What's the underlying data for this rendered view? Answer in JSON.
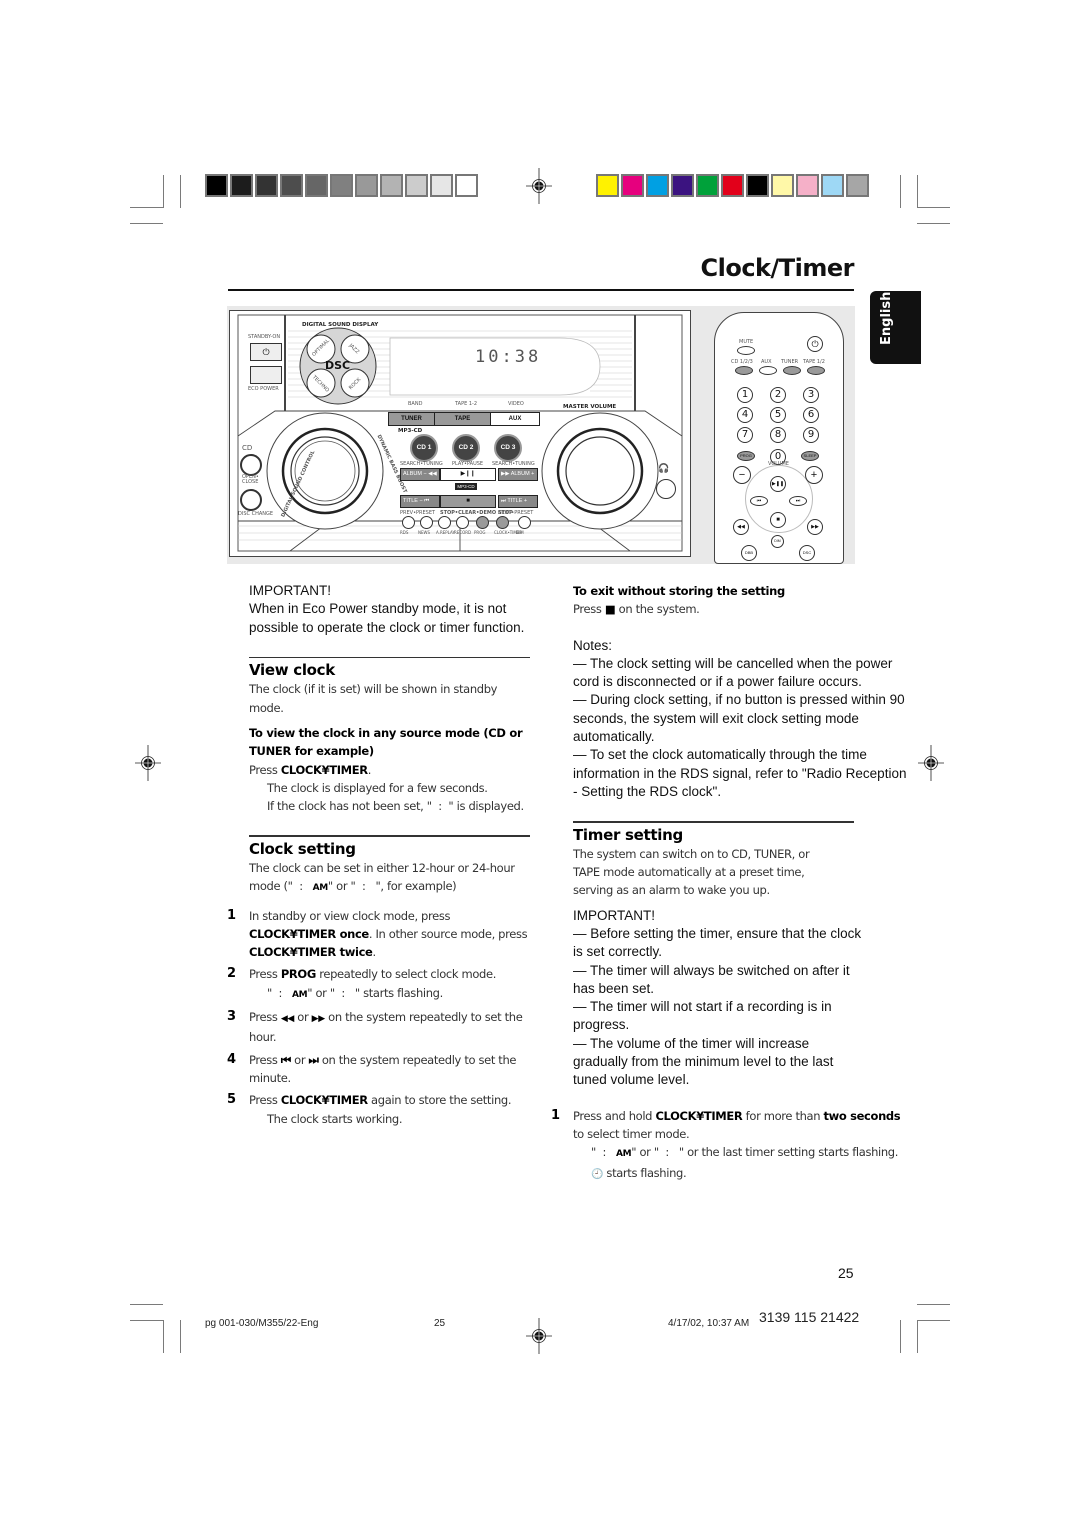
{
  "print_marks": {
    "grayscale_swatches": [
      "#000000",
      "#1c1c1c",
      "#333333",
      "#4d4d4d",
      "#666666",
      "#808080",
      "#999999",
      "#b3b3b3",
      "#cccccc",
      "#e6e6e6",
      "#ffffff"
    ],
    "color_swatches": [
      "#fff200",
      "#e6007e",
      "#00a0e3",
      "#3b1380",
      "#00a13a",
      "#e2001a",
      "#000000",
      "#fff8a8",
      "#f5b0c8",
      "#9ed8f5",
      "#a6a6a6"
    ]
  },
  "header": {
    "title": "Clock/Timer",
    "language_tab": "English"
  },
  "illustration": {
    "unit": {
      "display_label": "DIGITAL SOUND DISPLAY",
      "standby_label": "STANDBY-ON",
      "eco_power_label": "ECO POWER",
      "dsc_label": "DSC",
      "dsc_modes": [
        "OPTIMAL",
        "JAZZ",
        "TECHNO",
        "ROCK"
      ],
      "display_time": "10:38",
      "source_labels": [
        "BAND",
        "TAPE 1-2",
        "VIDEO"
      ],
      "source_buttons": [
        "TUNER",
        "TAPE",
        "AUX"
      ],
      "master_volume_label": "MASTER VOLUME",
      "mp3_cd_label": "MP3-CD",
      "cd_buttons": [
        "CD 1",
        "CD 2",
        "CD 3"
      ],
      "cd_label": "CD",
      "open_close_label": "OPEN• CLOSE",
      "disc_change_label": "DISC CHANGE",
      "left_knob_label": "DIGITAL SOUND CONTROL",
      "right_arc_label": "DYNAMIC BASS BOOST",
      "transport_top_labels": [
        "SEARCH•TUNING",
        "PLAY•PAUSE",
        "SEARCH•TUNING"
      ],
      "album_minus": "ALBUM −",
      "album_plus": "ALBUM +",
      "play_pause_symbol": "▶❙❙",
      "rewind_symbol": "◀◀",
      "forward_symbol": "▶▶",
      "title_minus": "TITLE −",
      "title_plus": "TITLE +",
      "prev_symbol": "⏮",
      "next_symbol": "⏭",
      "stop_symbol": "■",
      "transport_bottom_labels": [
        "PREV•PRESET",
        "STOP•CLEAR•DEMO STOP",
        "NEXT•PRESET"
      ],
      "small_buttons": [
        "RDS",
        "NEWS",
        "A.REPLAY",
        "RECORD",
        "PROG",
        "CLOCK•TIMER",
        "DIM"
      ]
    },
    "remote": {
      "mute_label": "MUTE",
      "source_labels": [
        "CD 1/2/3",
        "AUX",
        "TUNER",
        "TAPE 1/2"
      ],
      "digits": [
        "1",
        "2",
        "3",
        "4",
        "5",
        "6",
        "7",
        "8",
        "9",
        "0"
      ],
      "prog_label": "PROG",
      "sleep_label": "SLEEP",
      "volume_label": "VOLUME",
      "minus": "−",
      "plus": "+",
      "dim_label": "DIM",
      "dbb_label": "DBB",
      "dsc_label": "DSC"
    }
  },
  "left_column": {
    "important_heading": "IMPORTANT!",
    "important_text": "When in Eco Power standby mode, it is not possible to operate the clock or timer function.",
    "view_clock": {
      "heading": "View clock",
      "intro": "The clock (if it is set) will be shown in standby mode.",
      "subheading": "To view the clock in any source mode (CD or TUNER for example)",
      "press_prefix": "Press ",
      "press_button": "CLOCK¥TIMER",
      "press_suffix": ".",
      "result_1": "The clock is displayed for a few seconds.",
      "result_2": "If the clock has not been set, \"  :  \" is displayed."
    },
    "clock_setting": {
      "heading": "Clock setting",
      "intro_a": "The clock can be set in either 12-hour or 24-hour mode (\"  :   ",
      "intro_am": "AM",
      "intro_b": "\" or \"  :   \", for example)",
      "steps": [
        {
          "num": "1",
          "a": "In standby or view clock mode, press ",
          "b": "CLOCK¥TIMER once",
          "c": ".  In other source mode, press ",
          "d": "CLOCK¥TIMER twice",
          "e": "."
        },
        {
          "num": "2",
          "a": "Press ",
          "b": "PROG",
          "c": " repeatedly to select clock mode.",
          "sub_a": "\"  :   ",
          "sub_am": "AM",
          "sub_b": "\" or \"  :   \" starts flashing."
        },
        {
          "num": "3",
          "a": "Press ",
          "b": "◀◀",
          "c": " or ",
          "d": "▶▶",
          "e": " on the system repeatedly to set the hour."
        },
        {
          "num": "4",
          "a": "Press ",
          "b": "⏮",
          "c": " or ",
          "d": "⏭",
          "e": " on the system repeatedly to set the minute."
        },
        {
          "num": "5",
          "a": "Press ",
          "b": "CLOCK¥TIMER",
          "c": " again to store the setting.",
          "sub": "The clock starts working."
        }
      ]
    }
  },
  "right_column": {
    "exit_heading": "To exit without storing the setting",
    "exit_prefix": "Press ",
    "exit_symbol": "■",
    "exit_suffix": " on the system.",
    "notes_heading": "Notes:",
    "notes": [
      "—  The clock setting will be cancelled when the power cord is disconnected or if a power failure occurs.",
      "—  During clock setting, if no button is pressed within 90 seconds, the system will exit clock setting mode automatically.",
      "—  To set the clock automatically through the time information in the RDS signal, refer to \"Radio Reception - Setting the RDS clock\"."
    ],
    "timer_setting": {
      "heading": "Timer setting",
      "intro": "The system can switch on to CD, TUNER, or TAPE mode automatically at a preset time, serving as an alarm to wake you up.",
      "important_heading": "IMPORTANT!",
      "important_items": [
        "—  Before setting the timer, ensure that the clock is set correctly.",
        "—  The timer will always be switched on after it has been set.",
        "—  The timer will not start if a recording is in progress.",
        "—  The volume of the timer will increase gradually from the minimum level to the last tuned volume level."
      ],
      "step1": {
        "num": "1",
        "a": "Press and hold ",
        "b": "CLOCK¥TIMER",
        "c": " for more than ",
        "d": "two seconds",
        "e": " to select timer mode.",
        "sub_a": "\"  :   ",
        "sub_am": "AM",
        "sub_b": "\" or \"  :   \" or the last timer setting starts flashing.",
        "sub2": "starts flashing."
      }
    }
  },
  "page_number": "25",
  "footer": {
    "file": "pg 001-030/M355/22-Eng",
    "page": "25",
    "timestamp": "4/17/02, 10:37 AM",
    "code": "3139 115 21422"
  }
}
